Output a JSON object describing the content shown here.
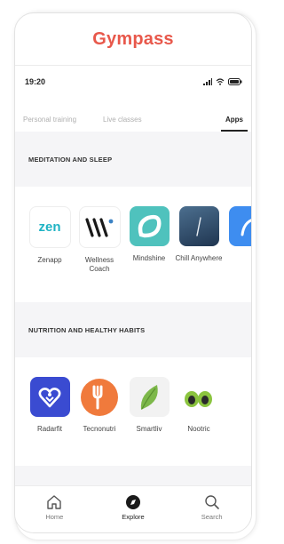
{
  "brand": {
    "name": "Gympass",
    "color": "#e8584b"
  },
  "status": {
    "time": "19:20",
    "icons": [
      "signal-icon",
      "wifi-icon",
      "battery-icon"
    ]
  },
  "tabs": [
    {
      "label": "Personal training",
      "active": false
    },
    {
      "label": "Live classes",
      "active": false
    },
    {
      "label": "Apps",
      "active": true
    }
  ],
  "sections": [
    {
      "title": "MEDITATION AND SLEEP",
      "apps": [
        {
          "label": "Zenapp",
          "icon": "zenapp-icon"
        },
        {
          "label": "Wellness Coach",
          "icon": "wellness-coach-icon"
        },
        {
          "label": "Mindshine",
          "icon": "mindshine-icon"
        },
        {
          "label": "Chill Anywhere",
          "icon": "chill-anywhere-icon"
        }
      ]
    },
    {
      "title": "NUTRITION AND HEALTHY HABITS",
      "apps": [
        {
          "label": "Radarfit",
          "icon": "radarfit-icon"
        },
        {
          "label": "Tecnonutri",
          "icon": "tecnonutri-icon"
        },
        {
          "label": "Smartliv",
          "icon": "smartliv-icon"
        },
        {
          "label": "Nootric",
          "icon": "nootric-icon"
        }
      ]
    }
  ],
  "nav": [
    {
      "label": "Home",
      "icon": "home-icon",
      "active": false
    },
    {
      "label": "Explore",
      "icon": "explore-icon",
      "active": true
    },
    {
      "label": "Search",
      "icon": "search-icon",
      "active": false
    }
  ]
}
